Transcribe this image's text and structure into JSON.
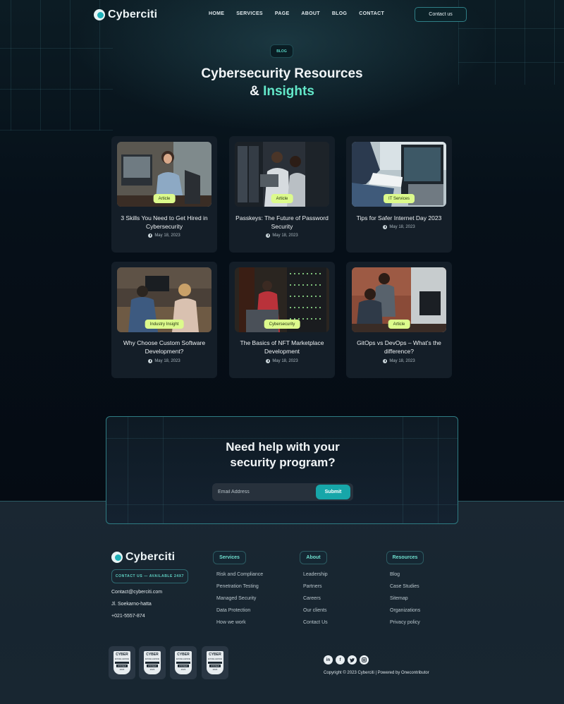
{
  "brand": {
    "name": "Cyberciti"
  },
  "nav": {
    "links": [
      "HOME",
      "SERVICES",
      "PAGE",
      "ABOUT",
      "BLOG",
      "CONTACT"
    ],
    "contact_label": "Contact us"
  },
  "hero": {
    "tag": "BLOG",
    "title_line1": "Cybersecurity Resources",
    "title_line2_prefix": "& ",
    "title_line2_accent": "Insights"
  },
  "posts": [
    {
      "badge": "Article",
      "title": "3 Skills You Need to Get Hired in Cybersecurity",
      "date": "May 18, 2023"
    },
    {
      "badge": "Article",
      "title": "Passkeys: The Future of Password Security",
      "date": "May 18, 2023"
    },
    {
      "badge": "IT Services",
      "title": "Tips for Safer Internet Day 2023",
      "date": "May 18, 2023"
    },
    {
      "badge": "Industry Insight",
      "title": "Why Choose Custom Software Development?",
      "date": "May 18, 2023"
    },
    {
      "badge": "Cybersecurity",
      "title": "The Basics of NFT Marketplace Development",
      "date": "May 18, 2023"
    },
    {
      "badge": "Article",
      "title": "GitOps vs DevOps – What’s the difference?",
      "date": "May 18, 2023"
    }
  ],
  "cta": {
    "title_line1": "Need help with your",
    "title_line2": "security program?",
    "email_placeholder": "Email Address",
    "submit_label": "Submit"
  },
  "footer": {
    "availability": "CONTACT US — AVAILABLE 24X7",
    "email": "Contact@cyberciti.com",
    "address": "Jl. Soekarno-hatta",
    "phone": "+021-5557-874",
    "columns": [
      {
        "heading": "Services",
        "items": [
          "Risk and Compliance",
          "Penetration Testing",
          "Managed Security",
          "Data Protection",
          "How we work"
        ]
      },
      {
        "heading": "About",
        "items": [
          "Leadership",
          "Partners",
          "Careers",
          "Our clients",
          "Contact Us"
        ]
      },
      {
        "heading": "Resources",
        "items": [
          "Blog",
          "Case Studies",
          "Sitemap",
          "Organizations",
          "Privacy policy"
        ]
      }
    ],
    "awards": [
      {
        "line1": "CYBER",
        "line2": "EXCELLENCE",
        "line3": "WINNER",
        "line4": "2023"
      },
      {
        "line1": "CYBER",
        "line2": "EXCELLENCE",
        "line3": "WINNER",
        "line4": "2023"
      },
      {
        "line1": "CYBER",
        "line2": "EXCELLENCE",
        "line3": "WINNER",
        "line4": "2023"
      },
      {
        "line1": "CYBER",
        "line2": "EXCELLENCE",
        "line3": "WINNER",
        "line4": "2023"
      }
    ],
    "social": [
      "linkedin-icon",
      "facebook-icon",
      "twitter-icon",
      "instagram-icon"
    ],
    "copyright": "Copyright © 2023 Cyberciti | Powered by Onecontributor"
  },
  "colors": {
    "accent": "#63e8c9",
    "badge": "#dcfa8c",
    "button": "#17a6a9"
  }
}
